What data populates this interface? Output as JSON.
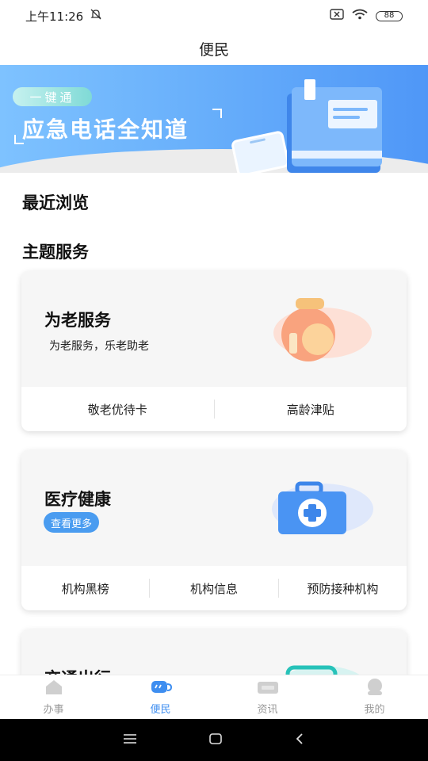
{
  "status_bar": {
    "time": "上午11:26",
    "battery": "88"
  },
  "header": {
    "title": "便民"
  },
  "banner": {
    "tag": "一键通",
    "title": "应急电话全知道"
  },
  "recent": {
    "title": "最近浏览"
  },
  "topics": {
    "title": "主题服务"
  },
  "cards": [
    {
      "title": "为老服务",
      "subtitle": "为老服务，乐老助老",
      "links": [
        "敬老优待卡",
        "高龄津贴"
      ]
    },
    {
      "title": "医疗健康",
      "more_label": "查看更多",
      "links": [
        "机构黑榜",
        "机构信息",
        "预防接种机构"
      ]
    },
    {
      "title": "交通出行"
    }
  ],
  "tabs": [
    {
      "label": "办事",
      "icon": "building-icon"
    },
    {
      "label": "便民",
      "icon": "cup-icon",
      "active": true
    },
    {
      "label": "资讯",
      "icon": "news-icon"
    },
    {
      "label": "我的",
      "icon": "profile-icon"
    }
  ],
  "colors": {
    "accent": "#3e8ef0",
    "banner_start": "#7ec2ff",
    "banner_end": "#4f97f7"
  }
}
